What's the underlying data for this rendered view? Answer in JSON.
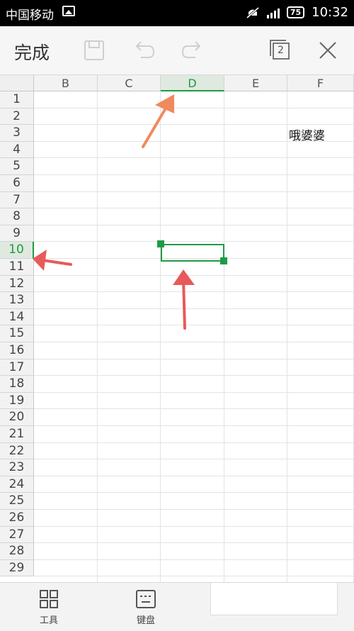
{
  "status_bar": {
    "carrier": "中国移动",
    "battery": "75",
    "time": "10:32",
    "icons": [
      "gallery-icon",
      "mute-icon",
      "signal-icon",
      "battery-icon"
    ]
  },
  "toolbar": {
    "done_label": "完成",
    "sheet_count": "2",
    "icons": [
      "save-icon",
      "undo-icon",
      "redo-icon",
      "sheets-icon",
      "close-icon"
    ]
  },
  "sheet": {
    "columns": [
      "B",
      "C",
      "D",
      "E",
      "F"
    ],
    "rows": [
      "1",
      "2",
      "3",
      "4",
      "5",
      "6",
      "7",
      "8",
      "9",
      "10",
      "11",
      "12",
      "13",
      "14",
      "15",
      "16",
      "17",
      "18",
      "19",
      "20",
      "21",
      "22",
      "23",
      "24",
      "25",
      "26",
      "27",
      "28",
      "29"
    ],
    "selected_column": "D",
    "selected_row": "10",
    "cells": [
      {
        "column": "F",
        "row": "3",
        "text": "哦婆婆"
      }
    ]
  },
  "bottom_bar": {
    "tools_label": "工具",
    "keyboard_label": "键盘"
  },
  "annotation_color": "#e74c3c",
  "highlight_color": "#1e9b45"
}
